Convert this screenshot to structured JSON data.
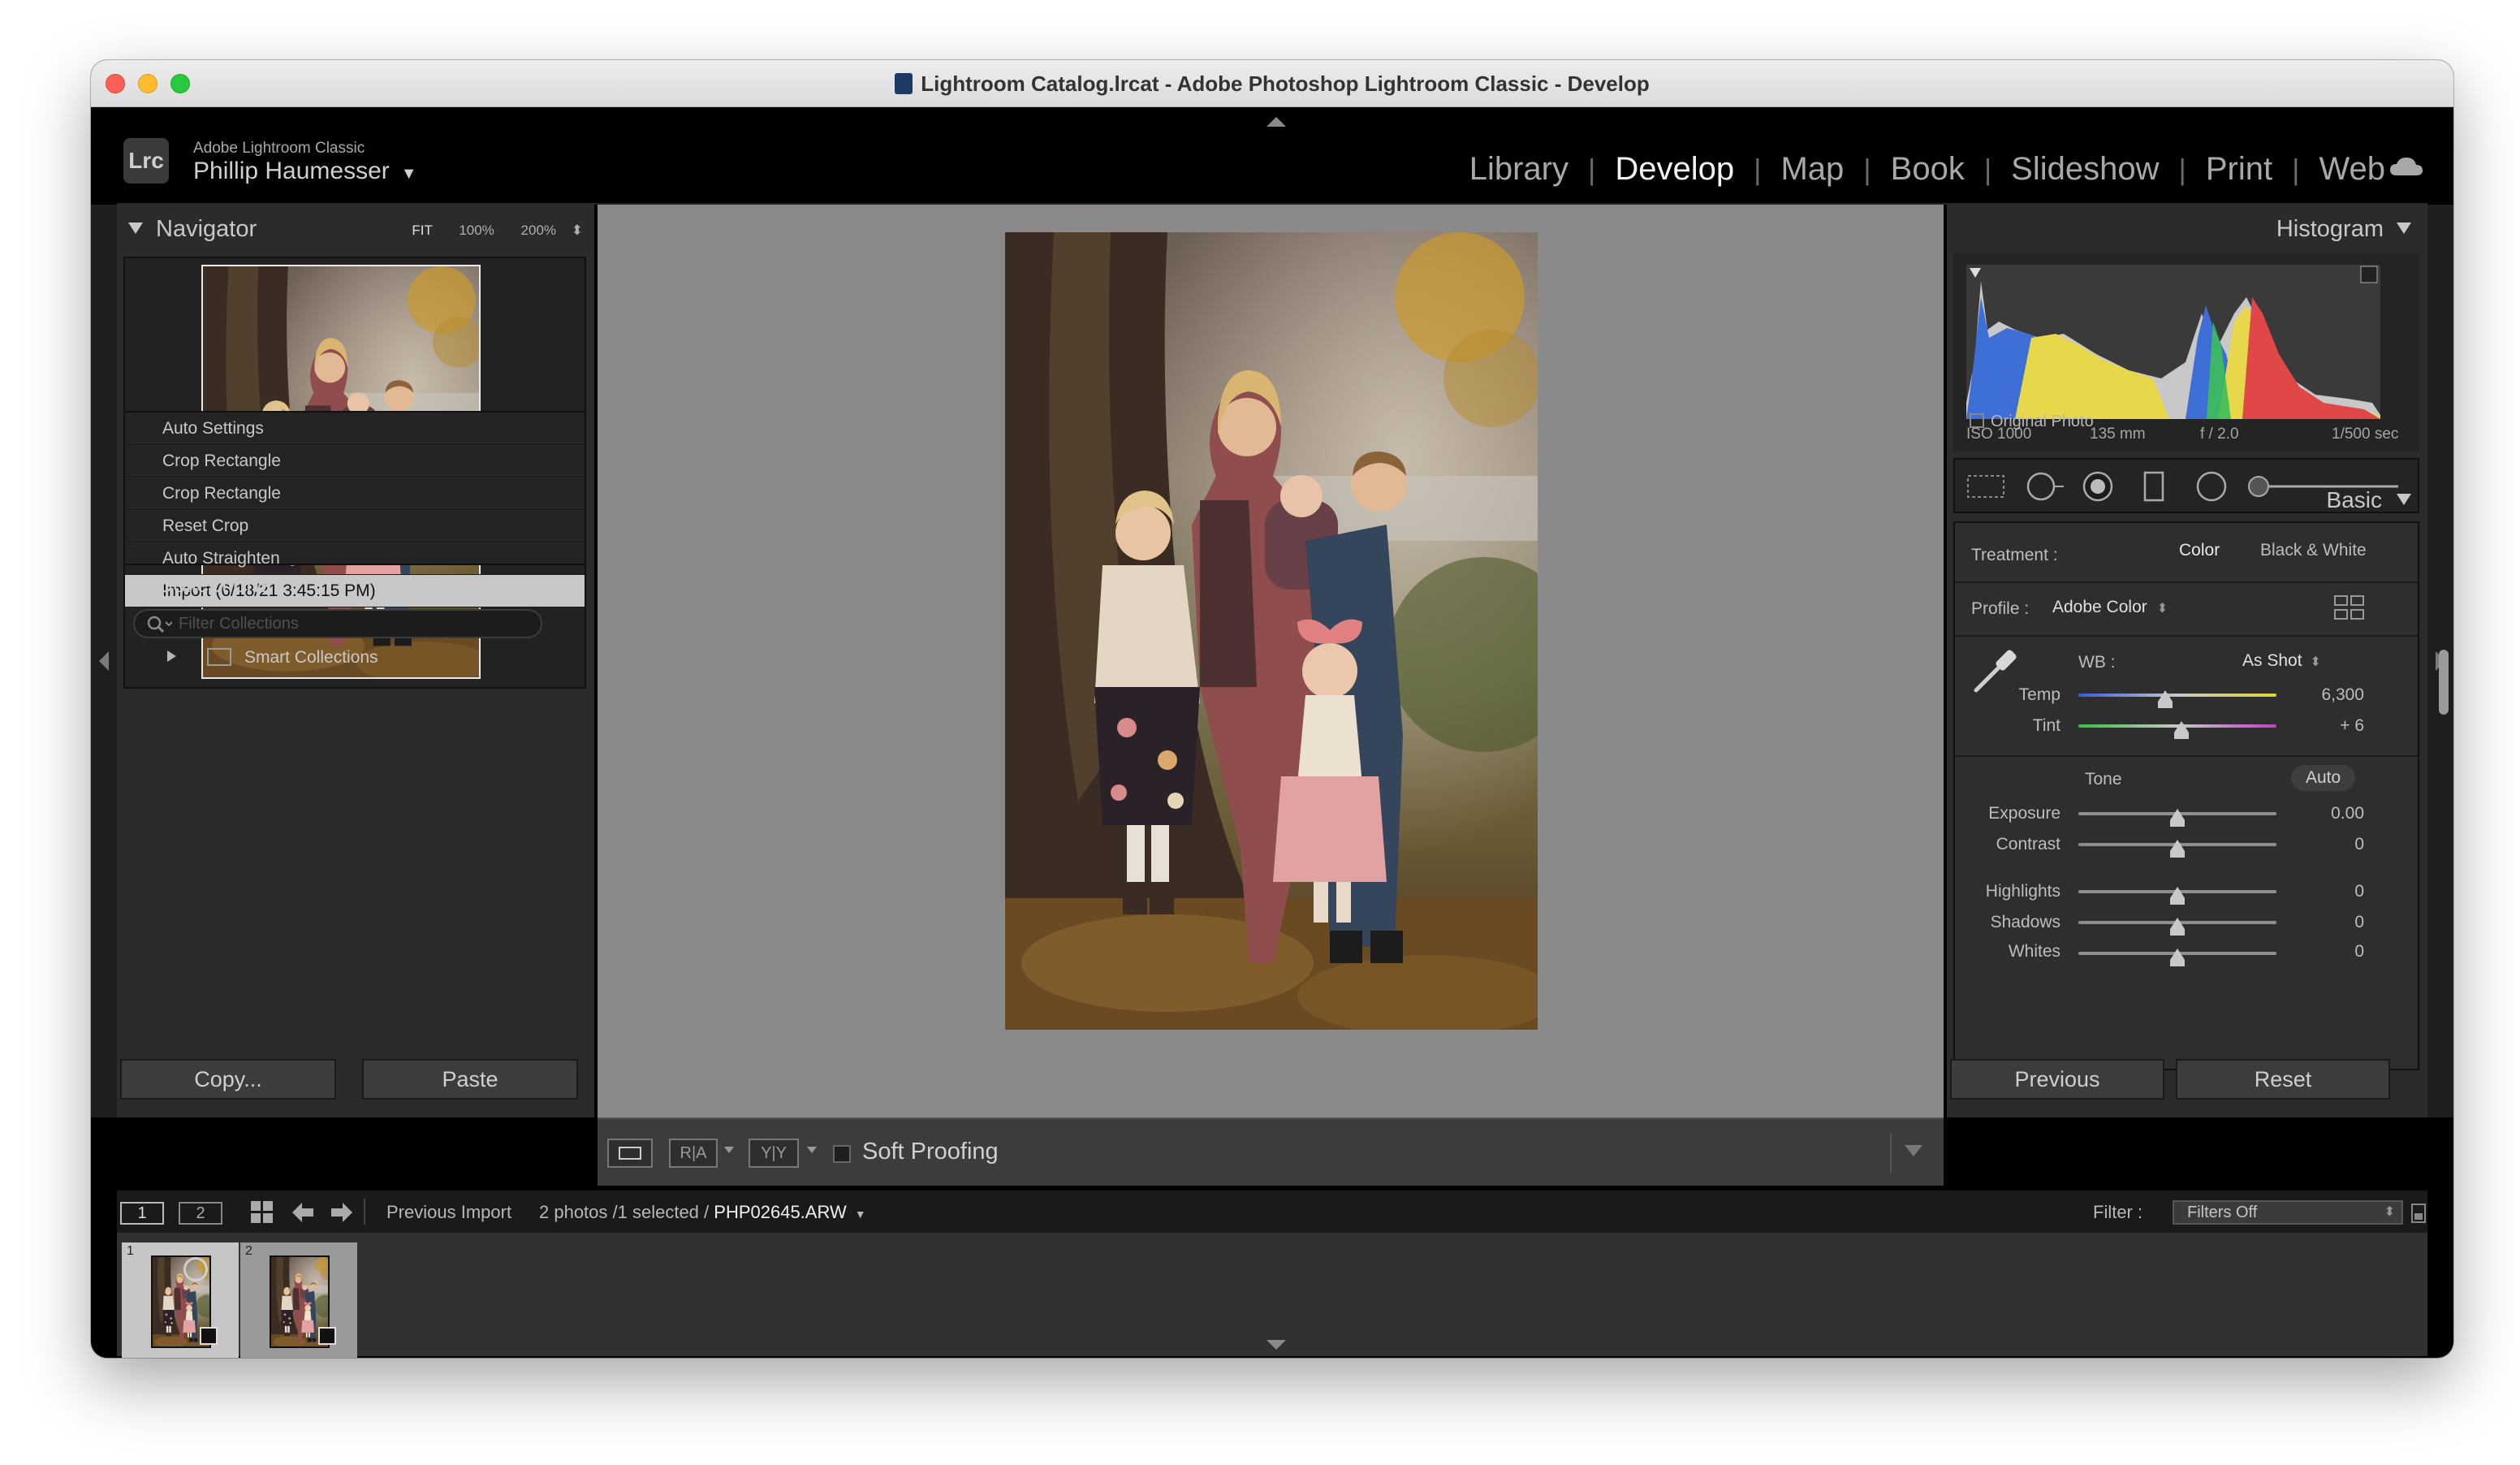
{
  "window": {
    "title": "Lightroom Catalog.lrcat - Adobe Photoshop Lightroom Classic - Develop"
  },
  "identity": {
    "badge": "Lrc",
    "app_name": "Adobe Lightroom Classic",
    "user": "Phillip Haumesser"
  },
  "modules": [
    {
      "label": "Library",
      "active": false
    },
    {
      "label": "Develop",
      "active": true
    },
    {
      "label": "Map",
      "active": false
    },
    {
      "label": "Book",
      "active": false
    },
    {
      "label": "Slideshow",
      "active": false
    },
    {
      "label": "Print",
      "active": false
    },
    {
      "label": "Web",
      "active": false
    }
  ],
  "navigator": {
    "title": "Navigator",
    "zoom": [
      "FIT",
      "100%",
      "200%"
    ]
  },
  "history": [
    {
      "label": "Auto Settings",
      "selected": false
    },
    {
      "label": "Crop Rectangle",
      "selected": false
    },
    {
      "label": "Crop Rectangle",
      "selected": false
    },
    {
      "label": "Reset Crop",
      "selected": false
    },
    {
      "label": "Auto Straighten",
      "selected": false
    },
    {
      "label": "Import (6/18/21 3:45:15 PM)",
      "selected": true
    }
  ],
  "collections": {
    "title": "Collections",
    "add": "+",
    "search_placeholder": "Filter Collections",
    "smart_collections": "Smart Collections"
  },
  "left_buttons": {
    "copy": "Copy...",
    "paste": "Paste"
  },
  "toolbar": {
    "soft_proofing": "Soft Proofing"
  },
  "histogram": {
    "title": "Histogram",
    "iso": "ISO 1000",
    "focal": "135 mm",
    "aperture": "f / 2.0",
    "shutter": "1/500 sec",
    "original_photo": "Original Photo"
  },
  "basic": {
    "title": "Basic",
    "treatment_label": "Treatment :",
    "treatment_color": "Color",
    "treatment_bw": "Black & White",
    "profile_label": "Profile :",
    "profile_value": "Adobe Color",
    "wb_label": "WB :",
    "wb_value": "As Shot",
    "temp": {
      "label": "Temp",
      "value": "6,300",
      "level": 0.44
    },
    "tint": {
      "label": "Tint",
      "value": "+ 6",
      "level": 0.52
    },
    "tone_label": "Tone",
    "auto_label": "Auto",
    "exposure": {
      "label": "Exposure",
      "value": "0.00",
      "level": 0.5
    },
    "contrast": {
      "label": "Contrast",
      "value": "0",
      "level": 0.5
    },
    "highlights": {
      "label": "Highlights",
      "value": "0",
      "level": 0.5
    },
    "shadows": {
      "label": "Shadows",
      "value": "0",
      "level": 0.5
    },
    "whites": {
      "label": "Whites",
      "value": "0",
      "level": 0.5
    }
  },
  "right_buttons": {
    "previous": "Previous",
    "reset": "Reset"
  },
  "filmstrip": {
    "view1": "1",
    "view2": "2",
    "source": "Previous Import",
    "count": "2 photos /1 selected /",
    "filename": "PHP02645.ARW",
    "filter_label": "Filter :",
    "filter_value": "Filters Off",
    "thumbs": [
      {
        "index": "1"
      },
      {
        "index": "2"
      }
    ]
  },
  "colors": {
    "accent_active": "#f2f2f2",
    "module_inactive": "#a8a8a8",
    "panel_bg": "#2b2b2b",
    "canvas_bg": "#8a8a8a"
  }
}
